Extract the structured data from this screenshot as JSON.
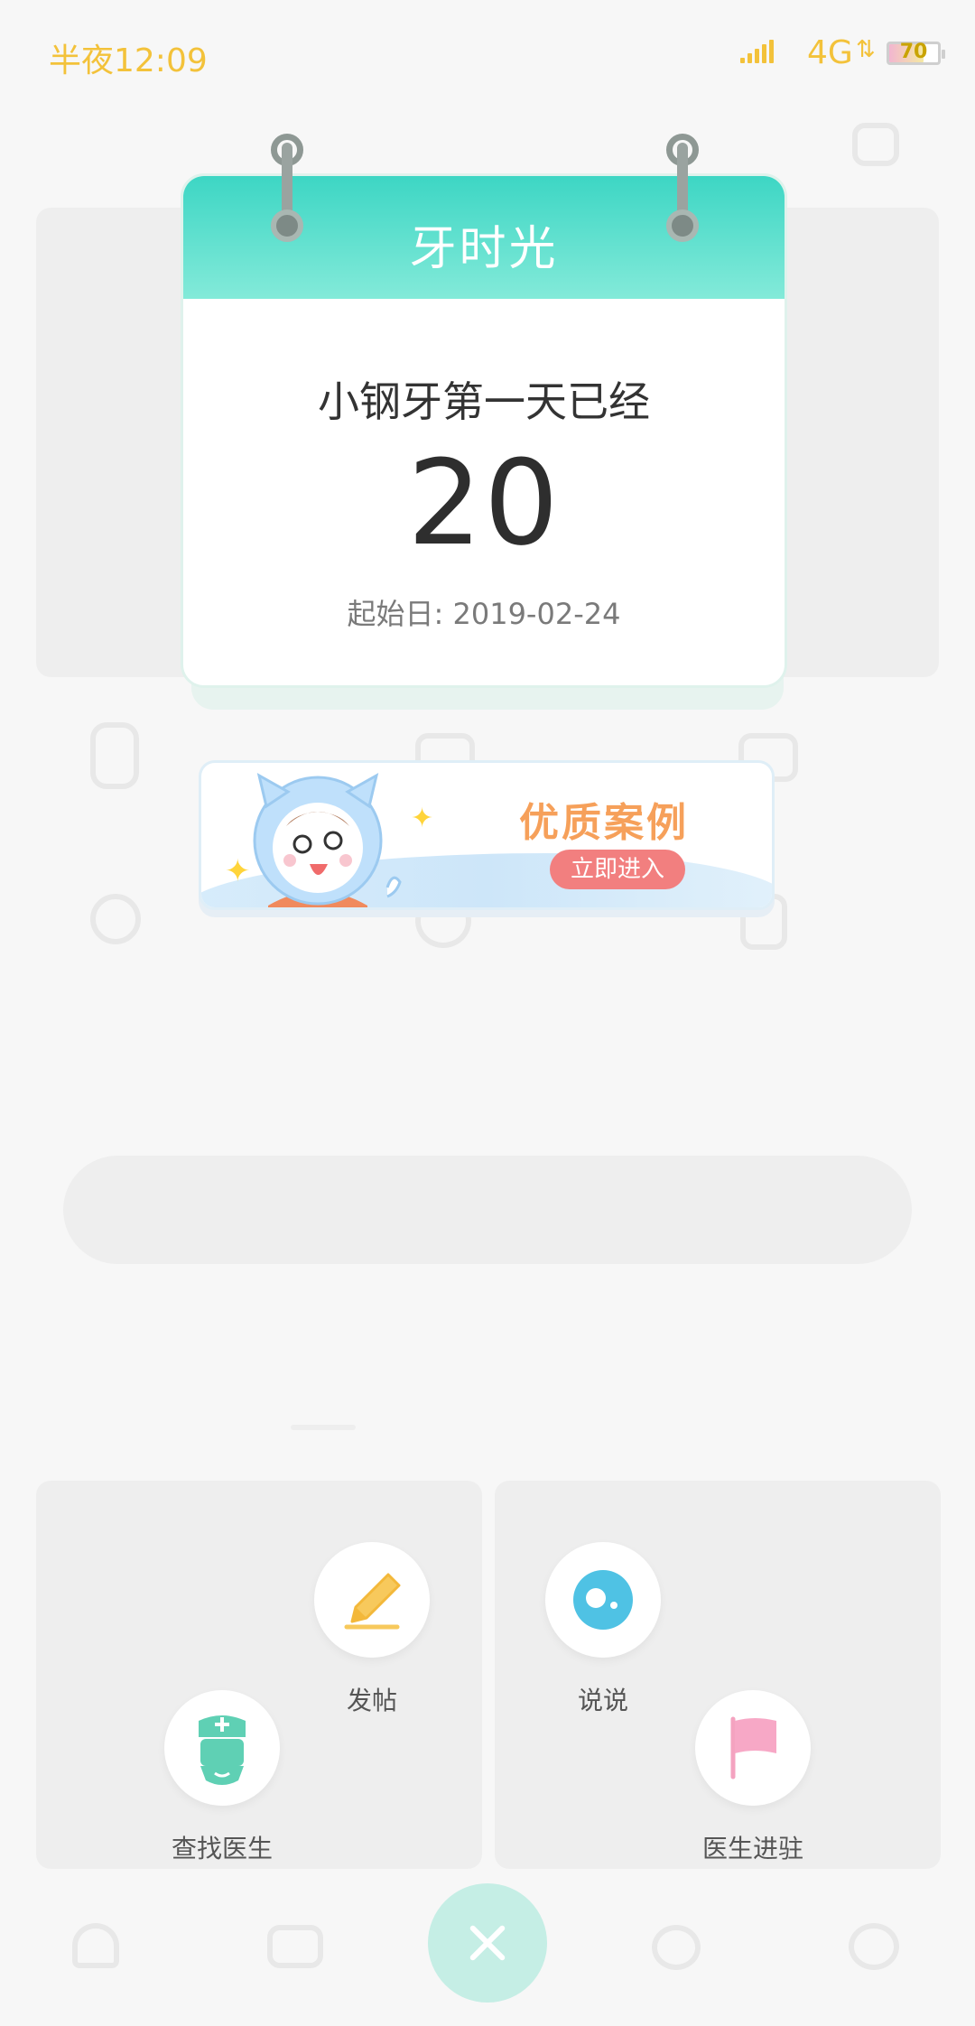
{
  "status_bar": {
    "time": "半夜12:09",
    "network": "4G",
    "battery": "70"
  },
  "calendar": {
    "title": "牙时光",
    "subtitle": "小钢牙第一天已经",
    "days": "20",
    "start_date": "起始日: 2019-02-24"
  },
  "banner": {
    "title": "优质案例",
    "button": "立即进入"
  },
  "actions": {
    "post": {
      "label": "发帖",
      "icon": "pencil-icon"
    },
    "say": {
      "label": "说说",
      "icon": "bubble-icon"
    },
    "find_doctor": {
      "label": "查找医生",
      "icon": "doctor-icon"
    },
    "doctor_join": {
      "label": "医生进驻",
      "icon": "flag-icon"
    }
  },
  "colors": {
    "accent": "#3dd6c4",
    "status": "#f3c23a",
    "banner_title": "#f6a05a",
    "banner_button": "#f27f7f"
  }
}
